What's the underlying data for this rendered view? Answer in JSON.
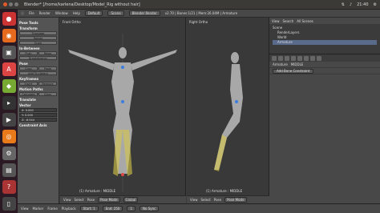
{
  "window": {
    "title": "Blender* [/home/karlena/Desktop/Model_Rig without hair]"
  },
  "tray": {
    "time": "21:40"
  },
  "menu": {
    "items": [
      "File",
      "Render",
      "Window",
      "Help"
    ],
    "layout": "Default",
    "scene": "Scene",
    "engine": "Blender Render",
    "stats": "v2.70 | Bones:1/21 | Mem:26.04M | Armature"
  },
  "toolshelf": {
    "sections": [
      {
        "header": "Pose Tools",
        "buttons": []
      },
      {
        "header": "Transform",
        "buttons": [
          [
            "Translate"
          ],
          [
            "Rotate"
          ],
          [
            "Scale"
          ]
        ]
      },
      {
        "header": "In-Between",
        "buttons": [
          [
            "Push",
            "Relax"
          ],
          [
            "Breakdowner"
          ]
        ]
      },
      {
        "header": "Pose",
        "buttons": [
          [
            "Copy",
            "Paste"
          ],
          [
            "Add To Library"
          ]
        ]
      },
      {
        "header": "Keyframes",
        "buttons": [
          [
            "Insert",
            "Remove"
          ]
        ]
      },
      {
        "header": "Motion Paths",
        "buttons": [
          [
            "Calculate",
            "Clear"
          ]
        ]
      }
    ],
    "translate": {
      "header": "Translate",
      "vector_label": "Vector",
      "fields": [
        "X: 0.000",
        "Y: 0.000",
        "Z: -6.544"
      ],
      "constraint_label": "Constraint Axis"
    }
  },
  "viewport_left": {
    "label": "Front Ortho",
    "status": "(1) Armature : MIDDLE"
  },
  "viewport_right": {
    "label": "Right Ortho",
    "status": "(1) Armature : MIDDLE"
  },
  "viewport_header": {
    "items": [
      "View",
      "Select",
      "Pose"
    ],
    "mode": "Pose Mode",
    "global": "Global"
  },
  "outliner": {
    "view": "View",
    "search": "Search",
    "scope": "All Scenes",
    "tree": [
      "Scene",
      "RenderLayers",
      "World",
      "Armature"
    ]
  },
  "properties": {
    "context": [
      "Armature",
      "MIDDLE"
    ],
    "add_constraint": "Add Bone Constraint"
  },
  "timeline": {
    "items": [
      "View",
      "Marker",
      "Frame",
      "Playback"
    ],
    "start": "Start: 1",
    "end": "End: 250",
    "current": "1",
    "sync": "No Sync"
  }
}
